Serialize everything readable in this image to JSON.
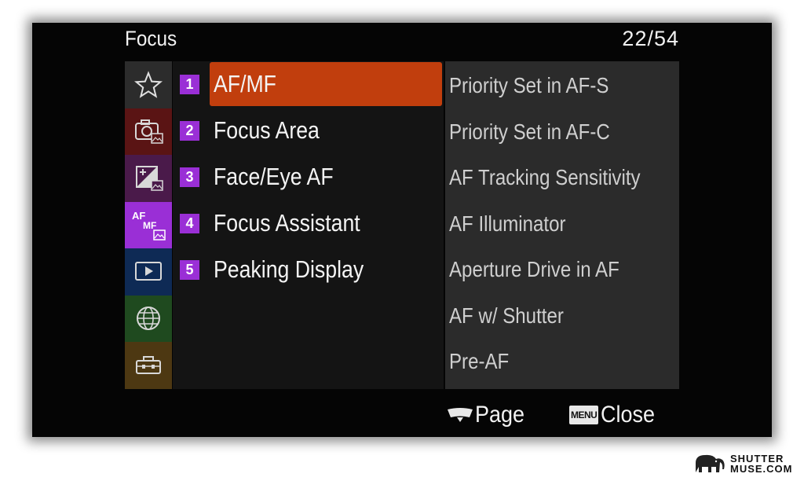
{
  "header": {
    "title": "Focus",
    "page_counter": "22/54"
  },
  "tabs": [
    {
      "icon": "star-icon",
      "color": "#2c2c2c"
    },
    {
      "icon": "camera-icon",
      "color": "#5a1414"
    },
    {
      "icon": "exposure-icon",
      "color": "#4a1a4a"
    },
    {
      "icon": "af-mf-icon",
      "color": "#9a2fd6",
      "text": "AF",
      "subtext": "MF",
      "selected": true
    },
    {
      "icon": "playback-icon",
      "color": "#0e2a55"
    },
    {
      "icon": "globe-icon",
      "color": "#1f4a1f"
    },
    {
      "icon": "toolbox-icon",
      "color": "#4d3812"
    }
  ],
  "menu": {
    "items": [
      {
        "number": "1",
        "label": "AF/MF",
        "selected": true
      },
      {
        "number": "2",
        "label": "Focus Area"
      },
      {
        "number": "3",
        "label": "Face/Eye AF"
      },
      {
        "number": "4",
        "label": "Focus Assistant"
      },
      {
        "number": "5",
        "label": "Peaking Display"
      }
    ],
    "selected_color": "#c13e0d",
    "number_color": "#9a2fd6"
  },
  "submenu": {
    "items": [
      "Priority Set in AF-S",
      "Priority Set in AF-C",
      "AF Tracking Sensitivity",
      "AF Illuminator",
      "Aperture Drive in AF",
      "AF w/ Shutter",
      "Pre-AF"
    ]
  },
  "footer": {
    "page_label": "Page",
    "menu_badge": "MENU",
    "close_label": "Close"
  },
  "watermark": {
    "line1": "SHUTTER",
    "line2": "MUSE.COM"
  }
}
